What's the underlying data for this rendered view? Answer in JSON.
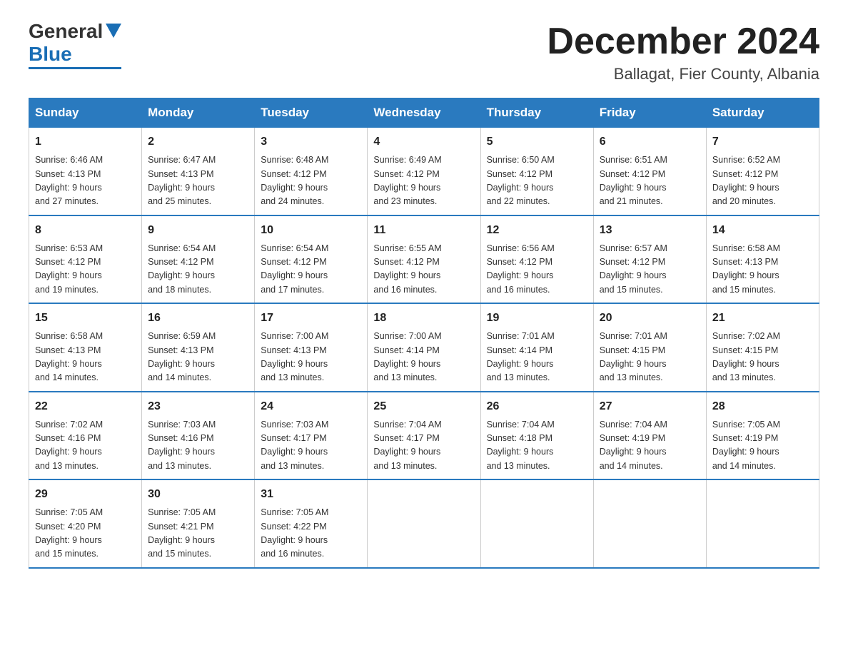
{
  "header": {
    "logo_general": "General",
    "logo_blue": "Blue",
    "month_year": "December 2024",
    "location": "Ballagat, Fier County, Albania"
  },
  "days_of_week": [
    "Sunday",
    "Monday",
    "Tuesday",
    "Wednesday",
    "Thursday",
    "Friday",
    "Saturday"
  ],
  "weeks": [
    [
      {
        "day": "1",
        "sunrise": "6:46 AM",
        "sunset": "4:13 PM",
        "daylight": "9 hours and 27 minutes."
      },
      {
        "day": "2",
        "sunrise": "6:47 AM",
        "sunset": "4:13 PM",
        "daylight": "9 hours and 25 minutes."
      },
      {
        "day": "3",
        "sunrise": "6:48 AM",
        "sunset": "4:12 PM",
        "daylight": "9 hours and 24 minutes."
      },
      {
        "day": "4",
        "sunrise": "6:49 AM",
        "sunset": "4:12 PM",
        "daylight": "9 hours and 23 minutes."
      },
      {
        "day": "5",
        "sunrise": "6:50 AM",
        "sunset": "4:12 PM",
        "daylight": "9 hours and 22 minutes."
      },
      {
        "day": "6",
        "sunrise": "6:51 AM",
        "sunset": "4:12 PM",
        "daylight": "9 hours and 21 minutes."
      },
      {
        "day": "7",
        "sunrise": "6:52 AM",
        "sunset": "4:12 PM",
        "daylight": "9 hours and 20 minutes."
      }
    ],
    [
      {
        "day": "8",
        "sunrise": "6:53 AM",
        "sunset": "4:12 PM",
        "daylight": "9 hours and 19 minutes."
      },
      {
        "day": "9",
        "sunrise": "6:54 AM",
        "sunset": "4:12 PM",
        "daylight": "9 hours and 18 minutes."
      },
      {
        "day": "10",
        "sunrise": "6:54 AM",
        "sunset": "4:12 PM",
        "daylight": "9 hours and 17 minutes."
      },
      {
        "day": "11",
        "sunrise": "6:55 AM",
        "sunset": "4:12 PM",
        "daylight": "9 hours and 16 minutes."
      },
      {
        "day": "12",
        "sunrise": "6:56 AM",
        "sunset": "4:12 PM",
        "daylight": "9 hours and 16 minutes."
      },
      {
        "day": "13",
        "sunrise": "6:57 AM",
        "sunset": "4:12 PM",
        "daylight": "9 hours and 15 minutes."
      },
      {
        "day": "14",
        "sunrise": "6:58 AM",
        "sunset": "4:13 PM",
        "daylight": "9 hours and 15 minutes."
      }
    ],
    [
      {
        "day": "15",
        "sunrise": "6:58 AM",
        "sunset": "4:13 PM",
        "daylight": "9 hours and 14 minutes."
      },
      {
        "day": "16",
        "sunrise": "6:59 AM",
        "sunset": "4:13 PM",
        "daylight": "9 hours and 14 minutes."
      },
      {
        "day": "17",
        "sunrise": "7:00 AM",
        "sunset": "4:13 PM",
        "daylight": "9 hours and 13 minutes."
      },
      {
        "day": "18",
        "sunrise": "7:00 AM",
        "sunset": "4:14 PM",
        "daylight": "9 hours and 13 minutes."
      },
      {
        "day": "19",
        "sunrise": "7:01 AM",
        "sunset": "4:14 PM",
        "daylight": "9 hours and 13 minutes."
      },
      {
        "day": "20",
        "sunrise": "7:01 AM",
        "sunset": "4:15 PM",
        "daylight": "9 hours and 13 minutes."
      },
      {
        "day": "21",
        "sunrise": "7:02 AM",
        "sunset": "4:15 PM",
        "daylight": "9 hours and 13 minutes."
      }
    ],
    [
      {
        "day": "22",
        "sunrise": "7:02 AM",
        "sunset": "4:16 PM",
        "daylight": "9 hours and 13 minutes."
      },
      {
        "day": "23",
        "sunrise": "7:03 AM",
        "sunset": "4:16 PM",
        "daylight": "9 hours and 13 minutes."
      },
      {
        "day": "24",
        "sunrise": "7:03 AM",
        "sunset": "4:17 PM",
        "daylight": "9 hours and 13 minutes."
      },
      {
        "day": "25",
        "sunrise": "7:04 AM",
        "sunset": "4:17 PM",
        "daylight": "9 hours and 13 minutes."
      },
      {
        "day": "26",
        "sunrise": "7:04 AM",
        "sunset": "4:18 PM",
        "daylight": "9 hours and 13 minutes."
      },
      {
        "day": "27",
        "sunrise": "7:04 AM",
        "sunset": "4:19 PM",
        "daylight": "9 hours and 14 minutes."
      },
      {
        "day": "28",
        "sunrise": "7:05 AM",
        "sunset": "4:19 PM",
        "daylight": "9 hours and 14 minutes."
      }
    ],
    [
      {
        "day": "29",
        "sunrise": "7:05 AM",
        "sunset": "4:20 PM",
        "daylight": "9 hours and 15 minutes."
      },
      {
        "day": "30",
        "sunrise": "7:05 AM",
        "sunset": "4:21 PM",
        "daylight": "9 hours and 15 minutes."
      },
      {
        "day": "31",
        "sunrise": "7:05 AM",
        "sunset": "4:22 PM",
        "daylight": "9 hours and 16 minutes."
      },
      null,
      null,
      null,
      null
    ]
  ]
}
